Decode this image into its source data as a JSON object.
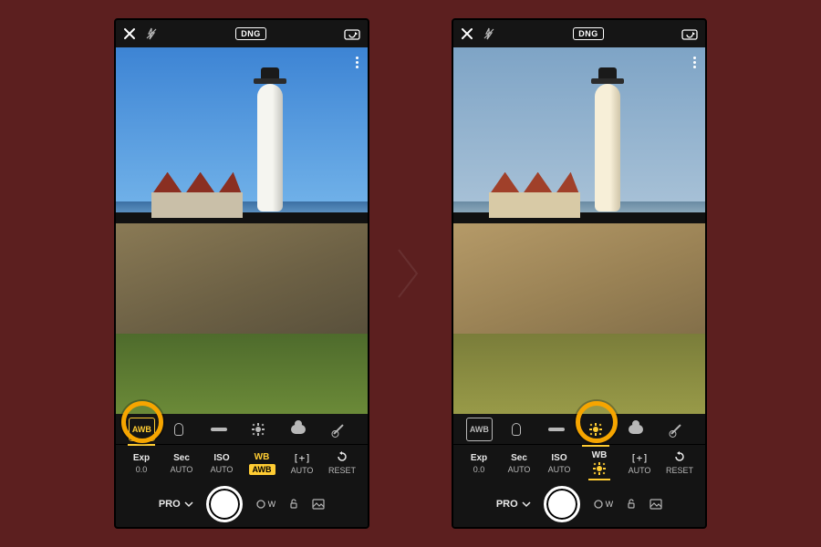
{
  "page": {
    "bg": "#5c1f1f"
  },
  "topbar": {
    "format_badge": "DNG"
  },
  "wb_presets": {
    "awb": "AWB"
  },
  "settings": {
    "exp": {
      "label": "Exp",
      "value": "0.0"
    },
    "sec": {
      "label": "Sec",
      "value": "AUTO"
    },
    "iso": {
      "label": "ISO",
      "value": "AUTO"
    },
    "wb": {
      "label": "WB",
      "value": "AWB"
    },
    "exp_comp": {
      "label": "[+]",
      "value": "AUTO"
    },
    "reset": {
      "label": "↺",
      "value": "RESET"
    }
  },
  "bottom": {
    "mode": "PRO",
    "wide_badge": "W"
  },
  "screens": {
    "left": {
      "highlight": "awb-preset",
      "wb_active": "awb-text",
      "cast": "cool"
    },
    "right": {
      "highlight": "daylight-preset",
      "wb_active": "daylight",
      "cast": "warm"
    }
  }
}
